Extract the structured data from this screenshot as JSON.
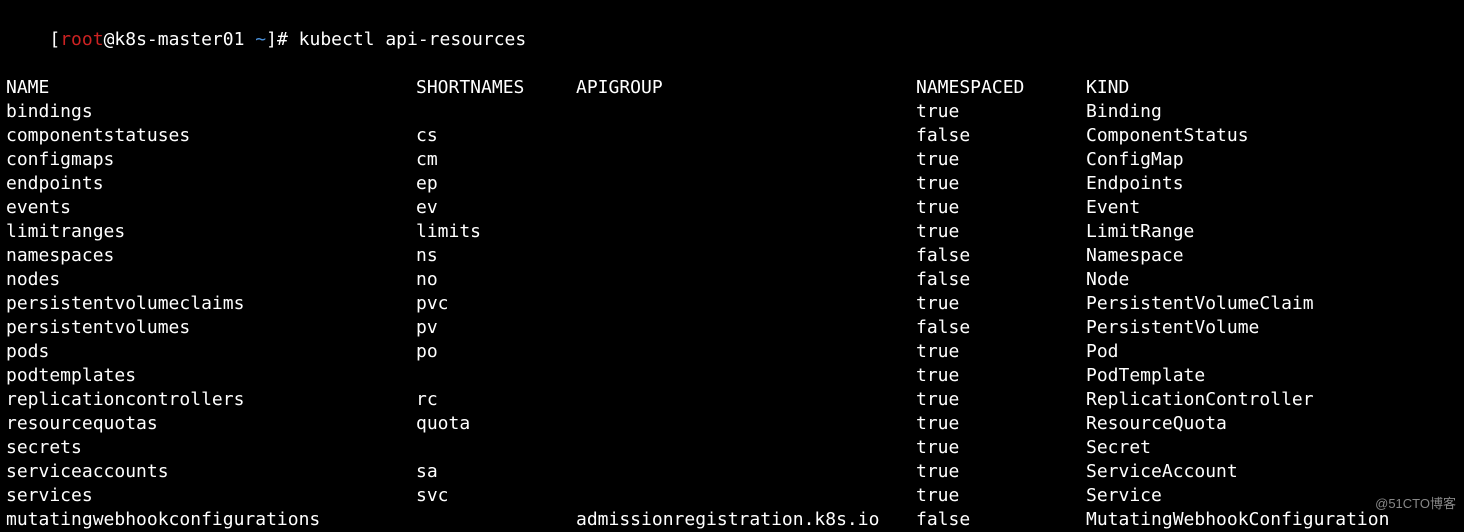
{
  "prompt": {
    "open_bracket": "[",
    "user": "root",
    "at_host": "@k8s-master01 ",
    "cwd": "~",
    "close_bracket": "]# ",
    "command": "kubectl api-resources"
  },
  "headers": {
    "name": "NAME",
    "shortnames": "SHORTNAMES",
    "apigroup": "APIGROUP",
    "namespaced": "NAMESPACED",
    "kind": "KIND"
  },
  "rows": [
    {
      "name": "bindings",
      "short": "",
      "apigroup": "",
      "namespaced": "true",
      "kind": "Binding"
    },
    {
      "name": "componentstatuses",
      "short": "cs",
      "apigroup": "",
      "namespaced": "false",
      "kind": "ComponentStatus"
    },
    {
      "name": "configmaps",
      "short": "cm",
      "apigroup": "",
      "namespaced": "true",
      "kind": "ConfigMap"
    },
    {
      "name": "endpoints",
      "short": "ep",
      "apigroup": "",
      "namespaced": "true",
      "kind": "Endpoints"
    },
    {
      "name": "events",
      "short": "ev",
      "apigroup": "",
      "namespaced": "true",
      "kind": "Event"
    },
    {
      "name": "limitranges",
      "short": "limits",
      "apigroup": "",
      "namespaced": "true",
      "kind": "LimitRange"
    },
    {
      "name": "namespaces",
      "short": "ns",
      "apigroup": "",
      "namespaced": "false",
      "kind": "Namespace"
    },
    {
      "name": "nodes",
      "short": "no",
      "apigroup": "",
      "namespaced": "false",
      "kind": "Node"
    },
    {
      "name": "persistentvolumeclaims",
      "short": "pvc",
      "apigroup": "",
      "namespaced": "true",
      "kind": "PersistentVolumeClaim"
    },
    {
      "name": "persistentvolumes",
      "short": "pv",
      "apigroup": "",
      "namespaced": "false",
      "kind": "PersistentVolume"
    },
    {
      "name": "pods",
      "short": "po",
      "apigroup": "",
      "namespaced": "true",
      "kind": "Pod"
    },
    {
      "name": "podtemplates",
      "short": "",
      "apigroup": "",
      "namespaced": "true",
      "kind": "PodTemplate"
    },
    {
      "name": "replicationcontrollers",
      "short": "rc",
      "apigroup": "",
      "namespaced": "true",
      "kind": "ReplicationController"
    },
    {
      "name": "resourcequotas",
      "short": "quota",
      "apigroup": "",
      "namespaced": "true",
      "kind": "ResourceQuota"
    },
    {
      "name": "secrets",
      "short": "",
      "apigroup": "",
      "namespaced": "true",
      "kind": "Secret"
    },
    {
      "name": "serviceaccounts",
      "short": "sa",
      "apigroup": "",
      "namespaced": "true",
      "kind": "ServiceAccount"
    },
    {
      "name": "services",
      "short": "svc",
      "apigroup": "",
      "namespaced": "true",
      "kind": "Service"
    },
    {
      "name": "mutatingwebhookconfigurations",
      "short": "",
      "apigroup": "admissionregistration.k8s.io",
      "namespaced": "false",
      "kind": "MutatingWebhookConfiguration"
    }
  ],
  "watermark": "@51CTO博客"
}
